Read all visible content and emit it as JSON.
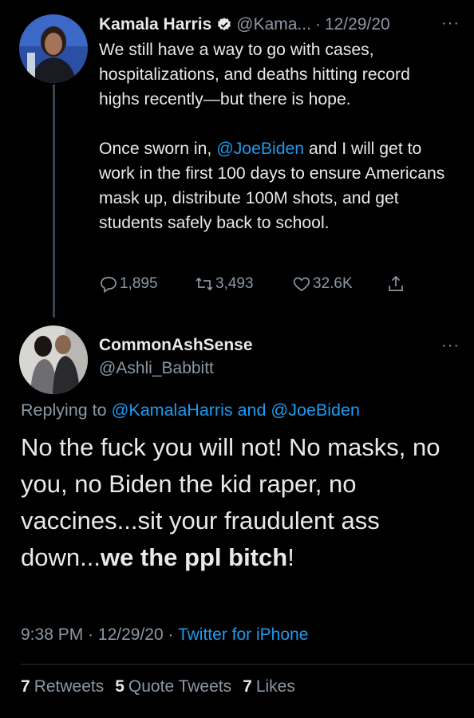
{
  "parent_tweet": {
    "author_name": "Kamala Harris",
    "handle": "@Kama...",
    "separator": "·",
    "date": "12/29/20",
    "text_line1": "We still have a way to go with cases, hospitalizations, and deaths hitting record highs recently—but there is hope.",
    "text_line2_prefix": "Once sworn in,",
    "mention": "@JoeBiden",
    "text_line2_suffix": "and I will get to work in the first 100 days to ensure Americans mask up, distribute 100M shots, and get students safely back to school.",
    "replies": "1,895",
    "retweets": "3,493",
    "likes": "32.6K"
  },
  "reply_tweet": {
    "author_name": "CommonAshSense",
    "handle": "@Ashli_Babbitt",
    "replying_label": "Replying to",
    "replying_mentions": "@KamalaHarris and @JoeBiden",
    "text_plain": "No the fuck you will not! No masks, no you, no Biden the kid raper,  no vaccines...sit your fraudulent ass down...",
    "text_bold": "we the ppl bitch",
    "text_end": "!",
    "time": "9:38 PM",
    "date": "12/29/20",
    "separator": "·",
    "source": "Twitter for iPhone",
    "retweets_count": "7",
    "retweets_label": "Retweets",
    "quotes_count": "5",
    "quotes_label": "Quote Tweets",
    "likes_count": "7",
    "likes_label": "Likes"
  },
  "more_glyph": "···",
  "colors": {
    "background": "#000000",
    "text": "#e7e9ea",
    "muted": "#8b98a5",
    "link": "#1d9bf0"
  },
  "icons": [
    "reply-icon",
    "retweet-icon",
    "like-icon",
    "share-icon",
    "verified-badge-icon"
  ]
}
